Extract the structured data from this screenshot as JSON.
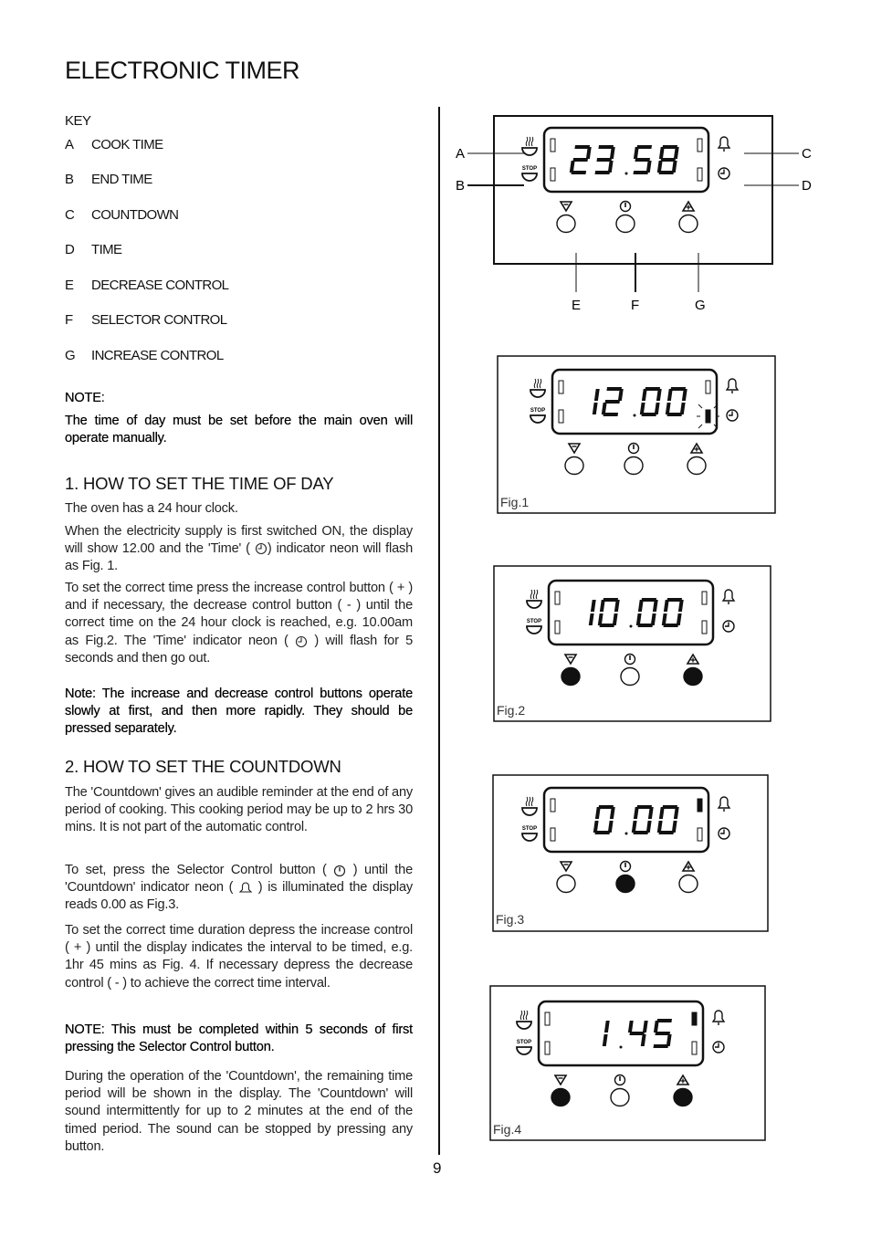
{
  "title": "ELECTRONIC TIMER",
  "key": {
    "heading": "KEY",
    "items": [
      {
        "letter": "A",
        "label": "COOK TIME"
      },
      {
        "letter": "B",
        "label": "END TIME"
      },
      {
        "letter": "C",
        "label": "COUNTDOWN"
      },
      {
        "letter": "D",
        "label": "TIME"
      },
      {
        "letter": "E",
        "label": "DECREASE CONTROL"
      },
      {
        "letter": "F",
        "label": "SELECTOR CONTROL"
      },
      {
        "letter": "G",
        "label": "INCREASE CONTROL"
      }
    ]
  },
  "note1": {
    "heading": "NOTE:",
    "text": "The time of day must be set before the main oven will operate manually."
  },
  "section1": {
    "heading": "1.  HOW TO SET THE TIME OF DAY",
    "p1": "The oven has a 24 hour clock.",
    "p2a": "When the electricity supply is first switched ON, the display will show 12.00 and the 'Time' (",
    "p2b": ") indicator neon will flash as Fig. 1.",
    "p3a": "To set the correct time press the increase control button ( + ) and if necessary, the decrease control button ( - ) until the correct time on the 24 hour clock is reached, e.g. 10.00am as Fig.2.  The 'Time' indicator neon (",
    "p3b": ") will flash for 5 seconds and then go out.",
    "note": "Note: The increase and decrease control buttons operate slowly at first, and then more rapidly.  They should be pressed separately."
  },
  "section2": {
    "heading": "2.  HOW TO SET THE COUNTDOWN",
    "p1": "The 'Countdown' gives an audible reminder at the end of any period of cooking.  This cooking period may be up to 2 hrs 30 mins.  It is not part of the automatic control.",
    "p2a": "To set, press the Selector Control button (",
    "p2b": ") until the 'Countdown' indicator neon (",
    "p2c": ") is illuminated the display reads 0.00 as Fig.3.",
    "p3": "To set the correct time duration depress the increase control ( + ) until the display indicates the interval to be timed, e.g. 1hr 45 mins as Fig. 4.  If necessary depress the decrease control ( - ) to achieve the correct time interval.",
    "note": "NOTE:  This must be completed within 5 seconds of first pressing the Selector Control button.",
    "p4": "During the operation of the 'Countdown', the remaining time period will be shown in the display. The 'Countdown' will sound intermittently for up to 2 minutes at the end of the timed period.  The sound can be stopped by pressing any button."
  },
  "page_number": "9",
  "diagrams": {
    "main": {
      "display": "23.58",
      "callouts": [
        "A",
        "B",
        "C",
        "D",
        "E",
        "F",
        "G"
      ],
      "stop_label": "STOP",
      "buttons_pressed": {
        "decrease": false,
        "selector": false,
        "increase": false
      }
    },
    "fig1": {
      "caption": "Fig.1",
      "display": "12.00",
      "time_indicator": "flashing",
      "countdown_indicator": "off",
      "buttons_pressed": {
        "decrease": false,
        "selector": false,
        "increase": false
      }
    },
    "fig2": {
      "caption": "Fig.2",
      "display": "10.00",
      "time_indicator": "off",
      "countdown_indicator": "off",
      "buttons_pressed": {
        "decrease": true,
        "selector": false,
        "increase": true
      }
    },
    "fig3": {
      "caption": "Fig.3",
      "display": "0.00",
      "time_indicator": "off",
      "countdown_indicator": "on",
      "buttons_pressed": {
        "decrease": false,
        "selector": true,
        "increase": false
      }
    },
    "fig4": {
      "caption": "Fig.4",
      "display": "1.45",
      "time_indicator": "off",
      "countdown_indicator": "on",
      "buttons_pressed": {
        "decrease": true,
        "selector": false,
        "increase": true
      }
    }
  }
}
